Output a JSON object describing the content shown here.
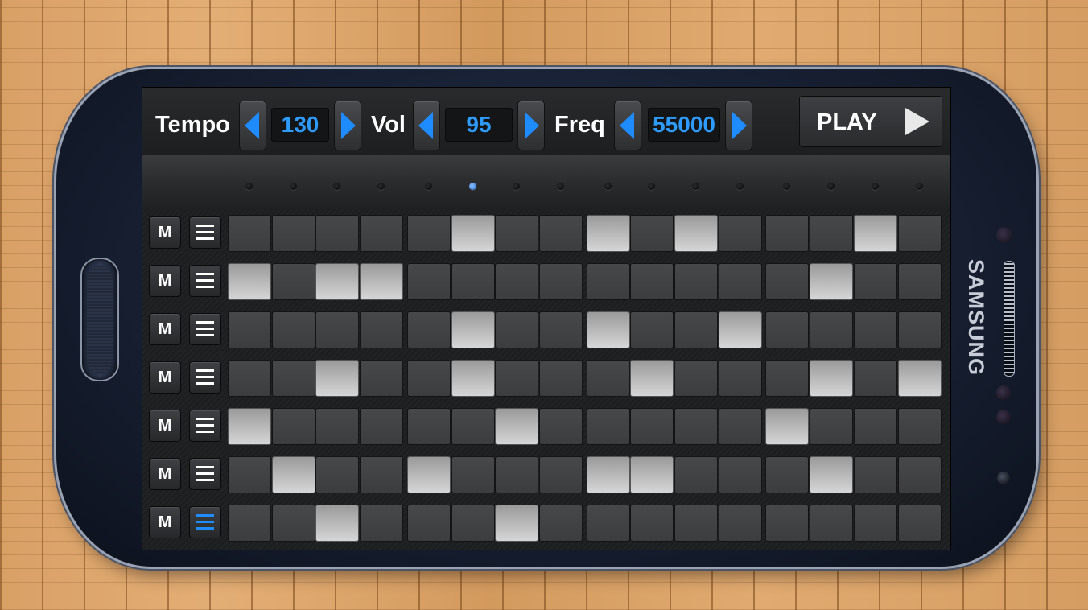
{
  "device": {
    "brand": "SAMSUNG"
  },
  "controls": {
    "tempo": {
      "label": "Tempo",
      "value": "130"
    },
    "volume": {
      "label": "Vol",
      "value": "95"
    },
    "frequency": {
      "label": "Freq",
      "value": "55000"
    },
    "play": {
      "label": "PLAY"
    }
  },
  "step_indicator": {
    "steps": 16,
    "current_step": 6
  },
  "tracks": [
    {
      "mute_label": "M",
      "menu_active": false,
      "steps": [
        0,
        0,
        0,
        0,
        0,
        1,
        0,
        0,
        1,
        0,
        1,
        0,
        0,
        0,
        1,
        0
      ]
    },
    {
      "mute_label": "M",
      "menu_active": false,
      "steps": [
        1,
        0,
        1,
        1,
        0,
        0,
        0,
        0,
        0,
        0,
        0,
        0,
        0,
        1,
        0,
        0
      ]
    },
    {
      "mute_label": "M",
      "menu_active": false,
      "steps": [
        0,
        0,
        0,
        0,
        0,
        1,
        0,
        0,
        1,
        0,
        0,
        1,
        0,
        0,
        0,
        0
      ]
    },
    {
      "mute_label": "M",
      "menu_active": false,
      "steps": [
        0,
        0,
        1,
        0,
        0,
        1,
        0,
        0,
        0,
        1,
        0,
        0,
        0,
        1,
        0,
        1
      ]
    },
    {
      "mute_label": "M",
      "menu_active": false,
      "steps": [
        1,
        0,
        0,
        0,
        0,
        0,
        1,
        0,
        0,
        0,
        0,
        0,
        1,
        0,
        0,
        0
      ]
    },
    {
      "mute_label": "M",
      "menu_active": false,
      "steps": [
        0,
        1,
        0,
        0,
        1,
        0,
        0,
        0,
        1,
        1,
        0,
        0,
        0,
        1,
        0,
        0
      ]
    },
    {
      "mute_label": "M",
      "menu_active": true,
      "steps": [
        0,
        0,
        1,
        0,
        0,
        0,
        1,
        0,
        0,
        0,
        0,
        0,
        0,
        0,
        0,
        0
      ]
    }
  ]
}
